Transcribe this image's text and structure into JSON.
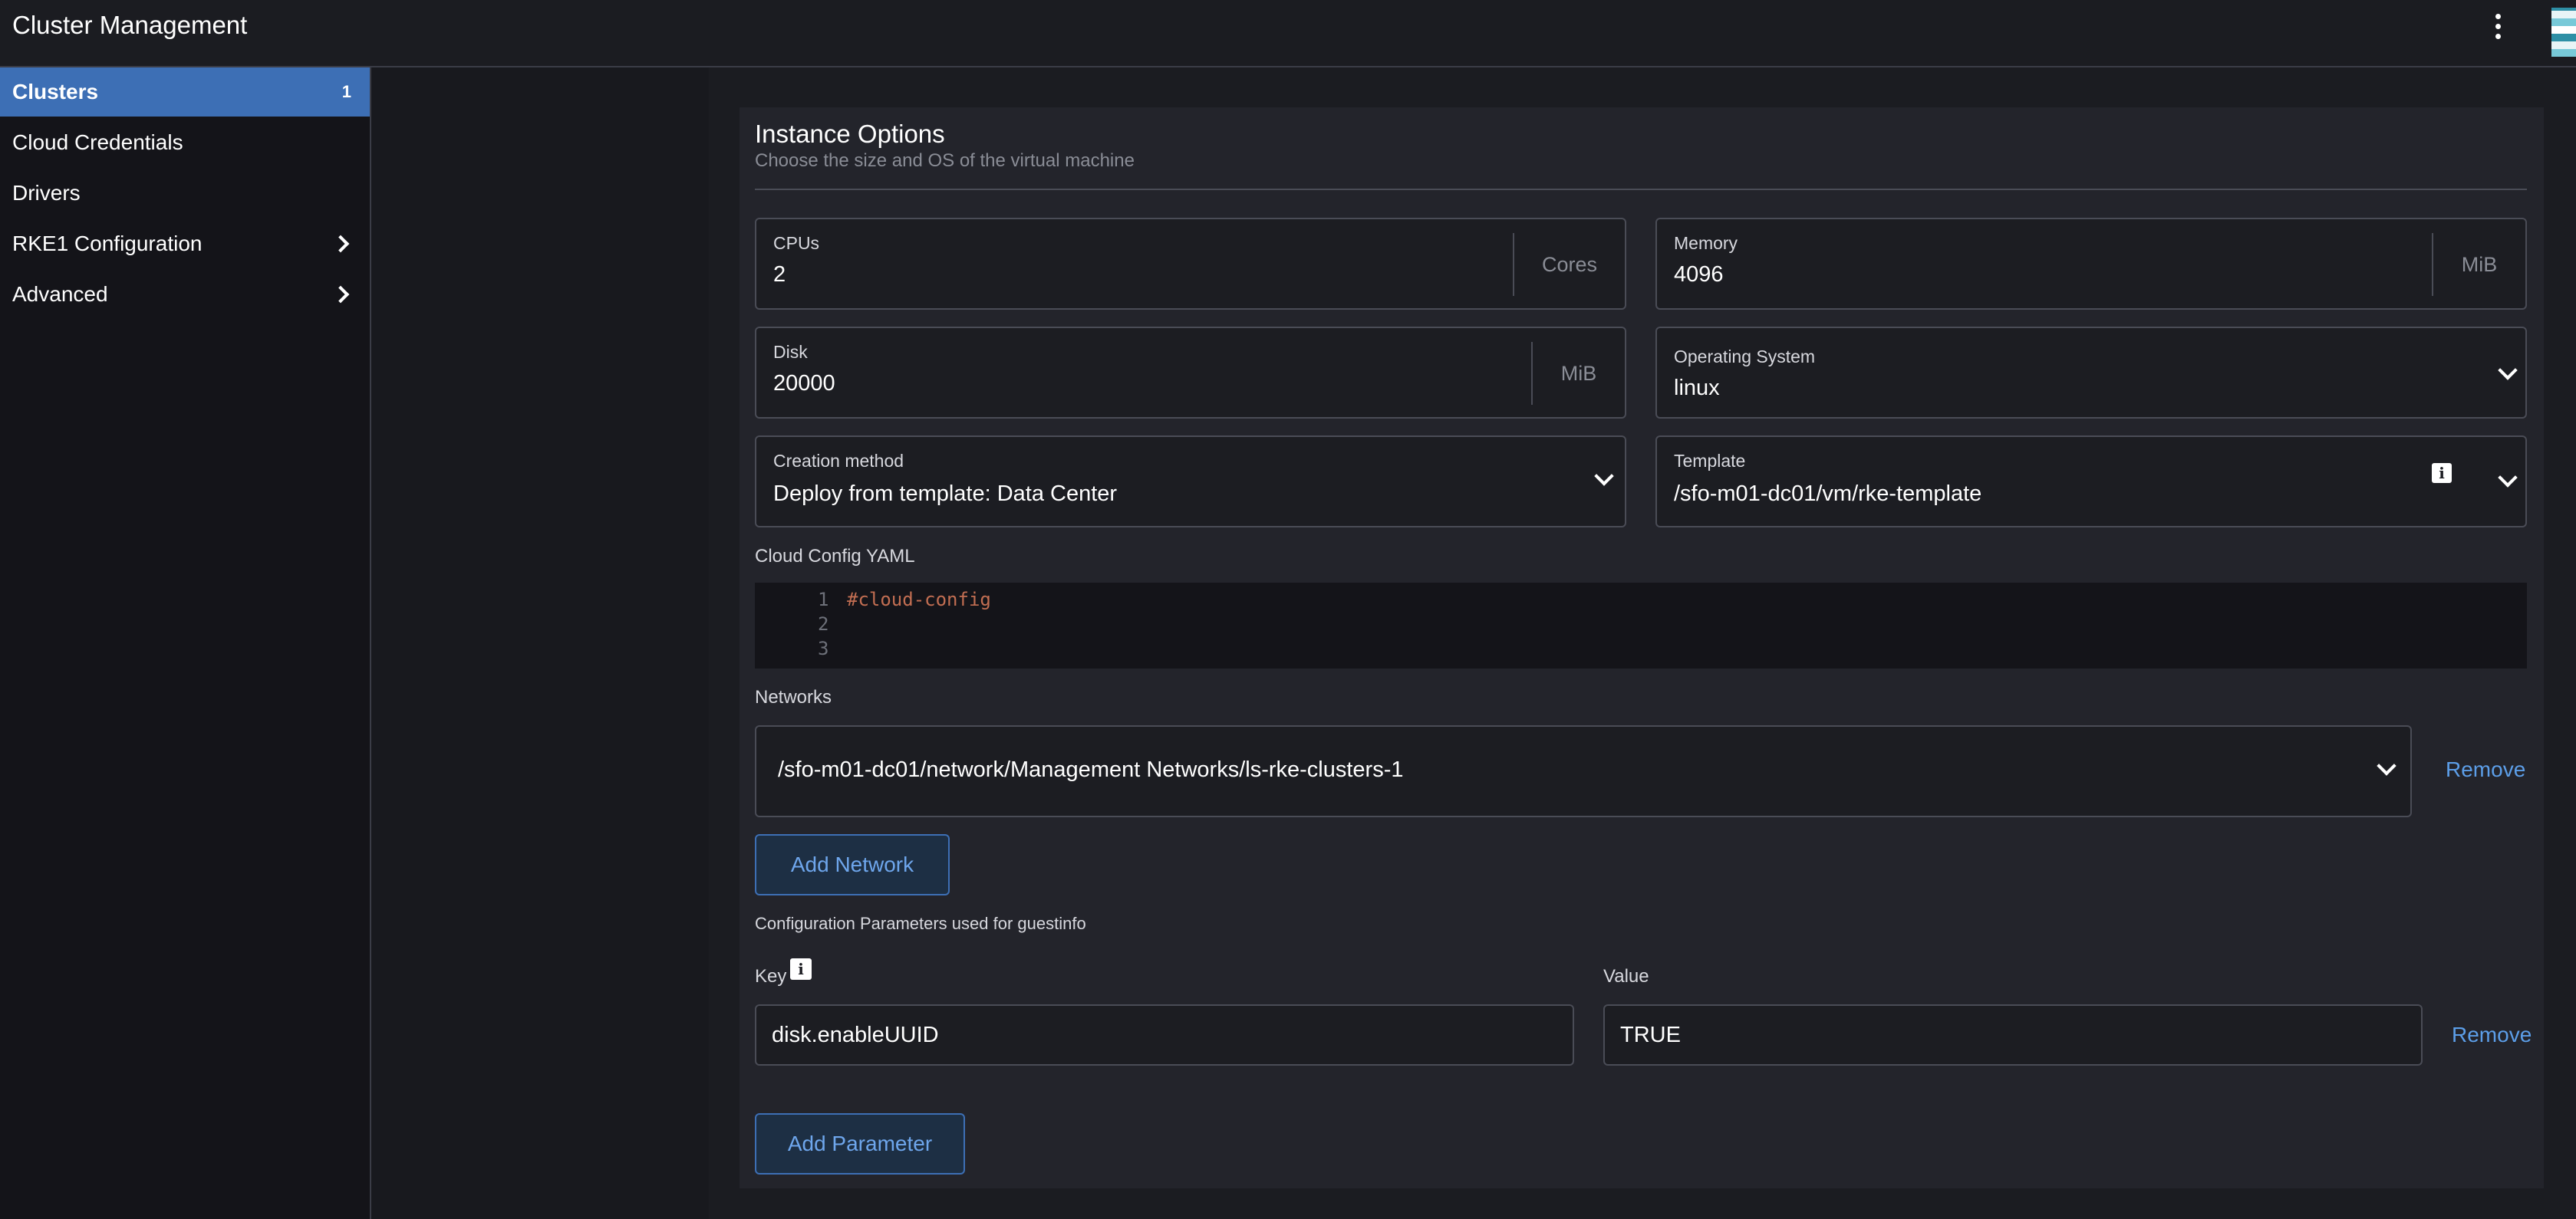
{
  "header": {
    "title": "Cluster Management",
    "menu_icon": "kebab-menu-icon"
  },
  "sidebar": {
    "items": [
      {
        "label": "Clusters",
        "count": "1",
        "active": true
      },
      {
        "label": "Cloud Credentials"
      },
      {
        "label": "Drivers"
      },
      {
        "label": "RKE1 Configuration",
        "expandable": true
      },
      {
        "label": "Advanced",
        "expandable": true
      }
    ]
  },
  "instance": {
    "title": "Instance Options",
    "subtitle": "Choose the size and OS of the virtual machine",
    "cpus": {
      "label": "CPUs",
      "value": "2",
      "unit": "Cores"
    },
    "memory": {
      "label": "Memory",
      "value": "4096",
      "unit": "MiB"
    },
    "disk": {
      "label": "Disk",
      "value": "20000",
      "unit": "MiB"
    },
    "os": {
      "label": "Operating System",
      "value": "linux"
    },
    "creation": {
      "label": "Creation method",
      "value": "Deploy from template: Data Center"
    },
    "template": {
      "label": "Template",
      "value": "/sfo-m01-dc01/vm/rke-template"
    },
    "cloud_config": {
      "label": "Cloud Config YAML",
      "lines": [
        {
          "num": "1",
          "text": "#cloud-config"
        },
        {
          "num": "2",
          "text": ""
        },
        {
          "num": "3",
          "text": ""
        }
      ]
    },
    "networks": {
      "label": "Networks",
      "value": "/sfo-m01-dc01/network/Management Networks/ls-rke-clusters-1",
      "remove_label": "Remove",
      "add_label": "Add Network"
    },
    "params": {
      "label": "Configuration Parameters used for guestinfo",
      "key_label": "Key",
      "value_label": "Value",
      "key_value": "disk.enableUUID",
      "value_value": "TRUE",
      "remove_label": "Remove",
      "add_label": "Add Parameter"
    }
  },
  "colors": {
    "accent": "#3d6fb5",
    "link": "#5c9ee8",
    "background": "#1b1c21"
  }
}
